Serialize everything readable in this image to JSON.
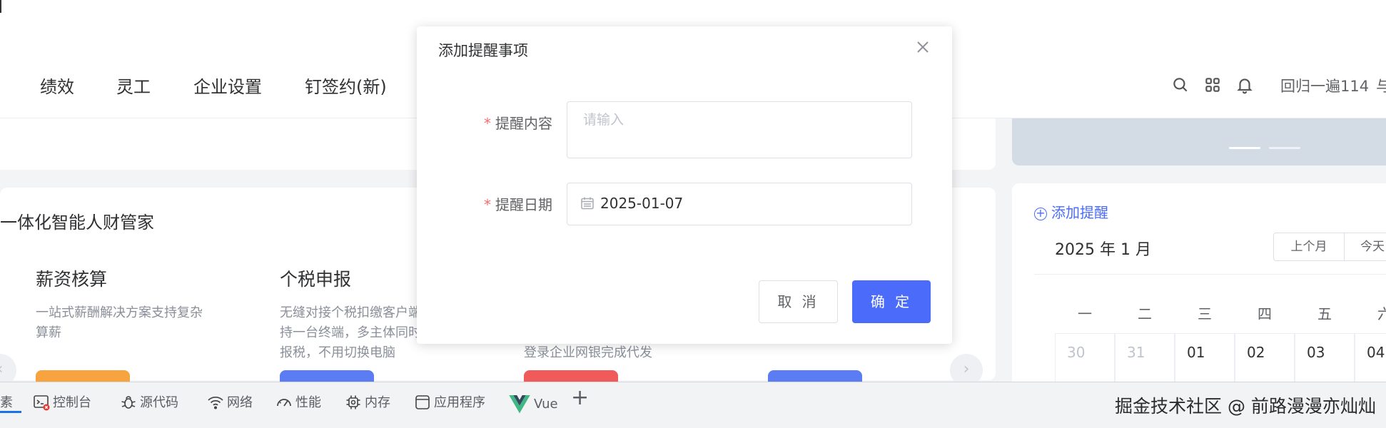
{
  "nav": {
    "items": [
      "绩效",
      "灵工",
      "企业设置",
      "钉签约(新)"
    ],
    "user_name": "回归一遍114",
    "user_extra": "与"
  },
  "left_card": {
    "title": "一体化智能人财管家",
    "features": [
      {
        "title": "薪资核算",
        "desc": "一站式薪酬解决方案支持复杂算薪",
        "button_color": "#f6a340"
      },
      {
        "title": "个税申报",
        "desc": "无缝对接个税扣缴客户端持一台终端，多主体同时报税，不用切换电脑",
        "button_color": "#5b7cf2"
      },
      {
        "title": "",
        "desc": "登录企业网银完成代发",
        "button_color": "#f05a5a"
      },
      {
        "title": "",
        "desc": "",
        "button_color": "#5b7cf2"
      }
    ],
    "arrow_left": "‹",
    "arrow_right": "›"
  },
  "calendar": {
    "add_label": "添加提醒",
    "month_label": "2025 年 1 月",
    "prev_month": "上个月",
    "today": "今天",
    "weekdays": [
      "一",
      "二",
      "三",
      "四",
      "五",
      "六"
    ],
    "days": [
      {
        "label": "30",
        "muted": true
      },
      {
        "label": "31",
        "muted": true
      },
      {
        "label": "01",
        "muted": false
      },
      {
        "label": "02",
        "muted": false
      },
      {
        "label": "03",
        "muted": false
      },
      {
        "label": "04",
        "muted": false
      }
    ]
  },
  "dialog": {
    "title": "添加提醒事项",
    "content_label": "提醒内容",
    "content_placeholder": "请输入",
    "date_label": "提醒日期",
    "date_value": "2025-01-07",
    "required_mark": "*",
    "cancel": "取 消",
    "confirm": "确 定"
  },
  "devtools": {
    "first_tab": "素",
    "tabs": [
      "控制台",
      "源代码",
      "网络",
      "性能",
      "内存",
      "应用程序",
      "Vue"
    ],
    "plus": "+",
    "watermark": "掘金技术社区 @ 前路漫漫亦灿灿"
  },
  "colors": {
    "primary": "#4b6bfb",
    "required": "#f56c6c",
    "banner": "#d3dbe4"
  }
}
